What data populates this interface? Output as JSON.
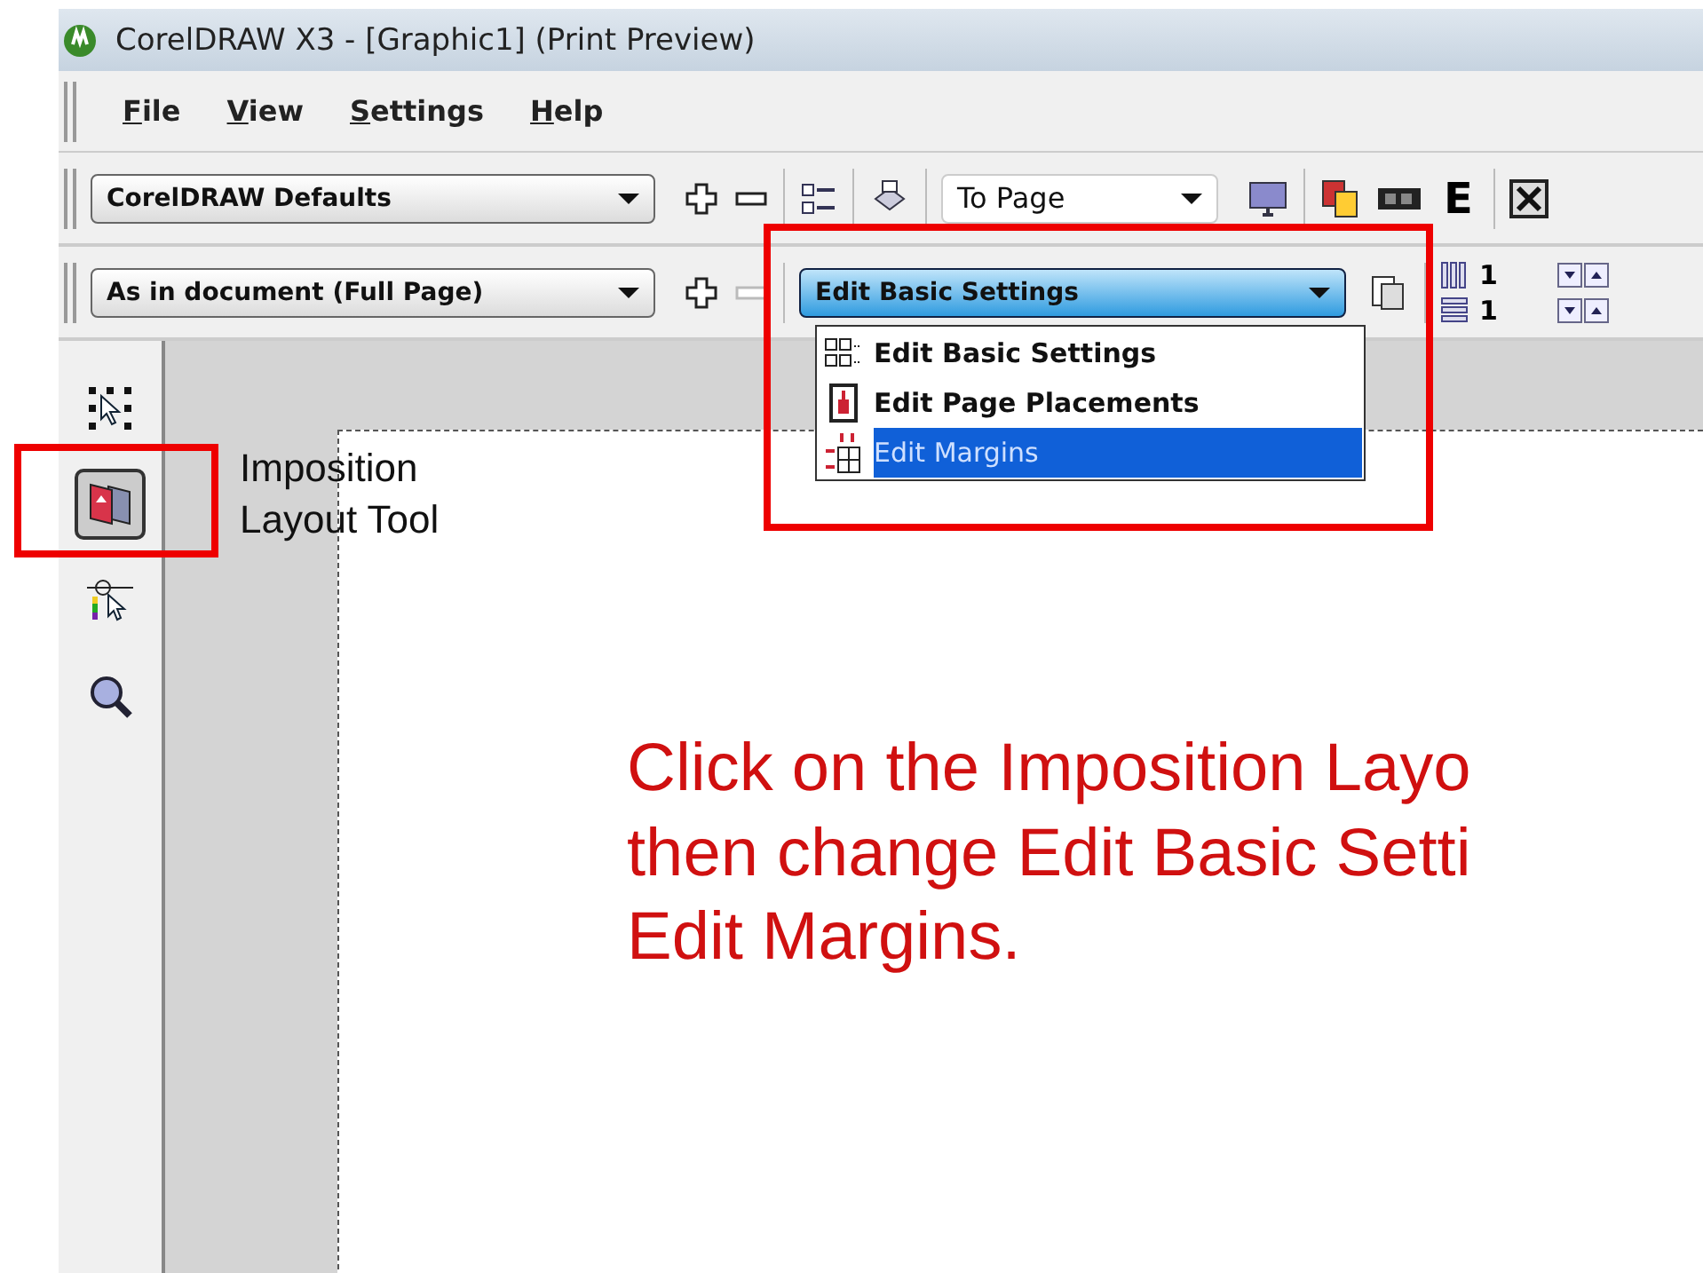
{
  "window": {
    "title": "CorelDRAW X3 - [Graphic1] (Print Preview)"
  },
  "menu": [
    {
      "label": "File"
    },
    {
      "label": "View"
    },
    {
      "label": "Settings"
    },
    {
      "label": "Help"
    }
  ],
  "toolbar_1": {
    "preset": "CorelDRAW Defaults",
    "zoom": "To Page",
    "e_button": "E"
  },
  "toolbar_2": {
    "preset": "As in document (Full Page)",
    "mode": "Edit Basic Settings",
    "columns": "1",
    "rows": "1"
  },
  "mode_menu": [
    {
      "label": "Edit Basic Settings",
      "kind": "grid",
      "selected": false
    },
    {
      "label": "Edit Page Placements",
      "kind": "page",
      "selected": false
    },
    {
      "label": "Edit Margins",
      "kind": "margins",
      "selected": true
    }
  ],
  "tools": [
    {
      "kind": "pick",
      "selected": false
    },
    {
      "kind": "imposition",
      "selected": true
    },
    {
      "kind": "marks",
      "selected": false
    },
    {
      "kind": "zoom",
      "selected": false
    }
  ],
  "callouts": {
    "tool_label": "Imposition Layout Tool",
    "instruction": [
      "Click on the Imposition Layo",
      "then change Edit Basic Setti",
      "Edit Margins."
    ]
  }
}
